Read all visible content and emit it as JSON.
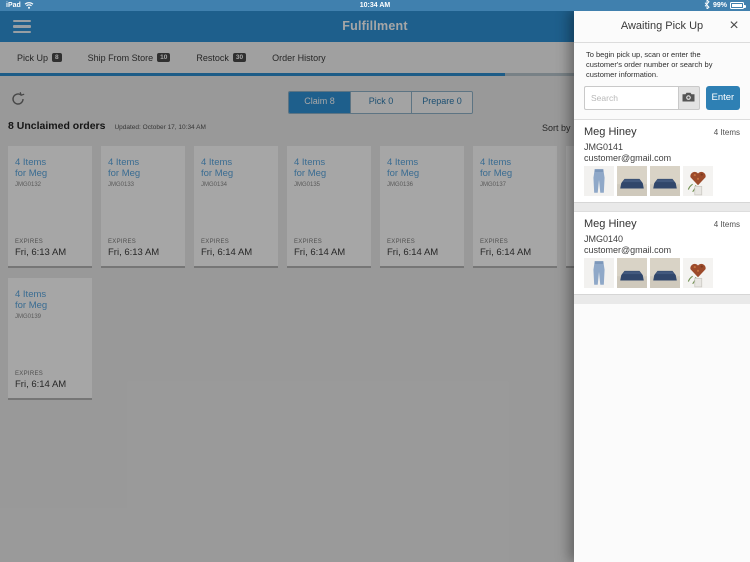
{
  "status_bar": {
    "device": "iPad",
    "time": "10:34 AM",
    "battery_percent": "99%"
  },
  "header": {
    "title": "Fulfillment"
  },
  "tab_bar": {
    "tabs": [
      {
        "label": "Pick Up",
        "badge": "8"
      },
      {
        "label": "Ship From Store",
        "badge": "10"
      },
      {
        "label": "Restock",
        "badge": "30"
      },
      {
        "label": "Order History",
        "badge": ""
      }
    ]
  },
  "toolbar": {
    "segments": [
      {
        "label": "Claim 8",
        "selected": true
      },
      {
        "label": "Pick 0",
        "selected": false
      },
      {
        "label": "Prepare 0",
        "selected": false
      }
    ],
    "sort_label": "Sort by"
  },
  "orders": {
    "heading": "8 Unclaimed orders",
    "updated": "Updated: October 17, 10:34 AM",
    "cards": [
      {
        "items_label": "4 Items",
        "customer_label": "for Meg",
        "order_no": "JMG0132",
        "expires_label": "EXPIRES",
        "expires_time": "Fri, 6:13 AM"
      },
      {
        "items_label": "4 Items",
        "customer_label": "for Meg",
        "order_no": "JMG0133",
        "expires_label": "EXPIRES",
        "expires_time": "Fri, 6:13 AM"
      },
      {
        "items_label": "4 Items",
        "customer_label": "for Meg",
        "order_no": "JMG0134",
        "expires_label": "EXPIRES",
        "expires_time": "Fri, 6:14 AM"
      },
      {
        "items_label": "4 Items",
        "customer_label": "for Meg",
        "order_no": "JMG0135",
        "expires_label": "EXPIRES",
        "expires_time": "Fri, 6:14 AM"
      },
      {
        "items_label": "4 Items",
        "customer_label": "for Meg",
        "order_no": "JMG0136",
        "expires_label": "EXPIRES",
        "expires_time": "Fri, 6:14 AM"
      },
      {
        "items_label": "4 Items",
        "customer_label": "for Meg",
        "order_no": "JMG0137",
        "expires_label": "EXPIRES",
        "expires_time": "Fri, 6:14 AM"
      },
      {
        "items_label": "4 Items",
        "customer_label": "for Meg",
        "order_no": "JMG0139",
        "expires_label": "EXPIRES",
        "expires_time": "Fri, 6:14 AM"
      }
    ]
  },
  "panel": {
    "title": "Awaiting Pick Up",
    "close_icon": "×",
    "instructions": "To begin pick up, scan or enter the customer's order number or search by customer information.",
    "search_placeholder": "Search",
    "enter_label": "Enter",
    "customers": [
      {
        "name": "Meg Hiney",
        "items_count": "4 Items",
        "order_no": "JMG0141",
        "email": "customer@gmail.com",
        "thumbnails": [
          "jeans",
          "pet-bed",
          "pet-bed",
          "flower-heart-art"
        ]
      },
      {
        "name": "Meg Hiney",
        "items_count": "4 Items",
        "order_no": "JMG0140",
        "email": "customer@gmail.com",
        "thumbnails": [
          "jeans",
          "pet-bed",
          "pet-bed",
          "flower-heart-art"
        ]
      }
    ]
  },
  "colors": {
    "status_bar_blue": "#4080ae",
    "header_blue": "#2e92d8",
    "accent_blue": "#2e80b4",
    "link_blue": "#5aa7e0",
    "badge_bg": "#4a4a4a"
  }
}
